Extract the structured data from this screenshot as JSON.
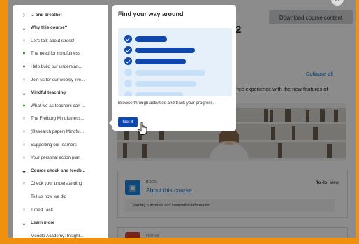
{
  "header": {
    "download_label": "Download course content",
    "course_number": "2"
  },
  "main": {
    "collapse_all": "Collapse all",
    "subtitle_fragment": "-free experience with the new features of"
  },
  "activity_card": {
    "type": "BOOK",
    "title": "About this course",
    "todo_label": "To do:",
    "todo_value": "View",
    "description": "Learning outcomes and completion information"
  },
  "activity_card_2": {
    "type": "FORUM"
  },
  "sidebar": {
    "items": [
      {
        "label": "... and breathe!",
        "kind": "section-collapsed"
      },
      {
        "label": "Why this course?",
        "kind": "section-expanded"
      },
      {
        "label": "Let's talk about stress!",
        "kind": "todo"
      },
      {
        "label": "The need for mindfulness",
        "kind": "done"
      },
      {
        "label": "Help build our understan...",
        "kind": "done"
      },
      {
        "label": "Join us for our weekly live...",
        "kind": "todo"
      },
      {
        "label": "Mindful teaching",
        "kind": "section-expanded"
      },
      {
        "label": "What we as teachers can ...",
        "kind": "done"
      },
      {
        "label": "The Freiburg Mindfulness...",
        "kind": "todo"
      },
      {
        "label": "(Research paper) Mindful...",
        "kind": "todo"
      },
      {
        "label": "Supporting our learners",
        "kind": "todo"
      },
      {
        "label": "Your personal action plan",
        "kind": "todo"
      },
      {
        "label": "Course check and feedb...",
        "kind": "section-expanded"
      },
      {
        "label": "Check your understanding",
        "kind": "todo"
      },
      {
        "label": "Tell us how we did",
        "kind": "none"
      },
      {
        "label": "Timed Task",
        "kind": "todo"
      },
      {
        "label": "Learn more",
        "kind": "section-expanded"
      },
      {
        "label": "Moodle Academy: Insight...",
        "kind": "none"
      }
    ]
  },
  "tour": {
    "title": "Find your way around",
    "body": "Browse through activities and track your progress.",
    "button": "Got it"
  },
  "colors": {
    "accent": "#0f47ad",
    "brand_orange": "#f0900f",
    "done_green": "#357a32",
    "link": "#0f6cbf"
  },
  "icons": {
    "check": "check-circle-icon",
    "chevron_down": "chevron-down-icon",
    "chevron_right": "chevron-right-icon",
    "book": "book-icon",
    "hand_cursor": "hand-pointer-icon",
    "close": "close-icon"
  }
}
